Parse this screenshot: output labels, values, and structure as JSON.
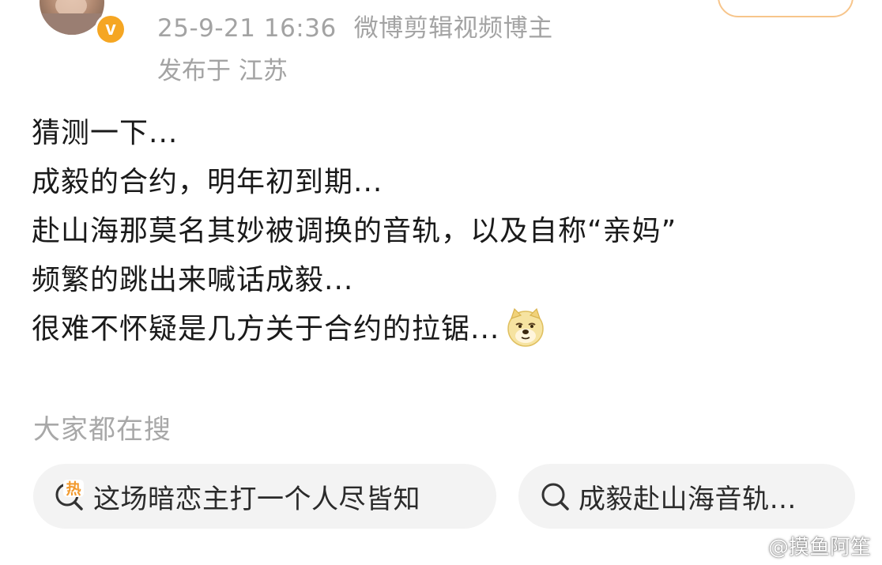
{
  "header": {
    "timestamp": "25-9-21 16:36",
    "source": "微博剪辑视频博主",
    "location": "发布于 江苏",
    "verified_badge": "v"
  },
  "post": {
    "lines": [
      "猜测一下...",
      "成毅的合约，明年初到期...",
      "赴山海那莫名其妙被调换的音轨，以及自称“亲妈”",
      "频繁的跳出来喊话成毅...",
      "很难不怀疑是几方关于合约的拉锯..."
    ],
    "emoji": "doge-emoji"
  },
  "searches": {
    "title": "大家都在搜",
    "items": [
      {
        "label": "这场暗恋主打一个人尽皆知",
        "icon": "hot-search-icon",
        "hot_badge": "热"
      },
      {
        "label": "成毅赴山海音轨…",
        "icon": "search-icon"
      }
    ]
  },
  "watermark": {
    "text": "@摸鱼阿笙",
    "icon": "weibo-logo-icon"
  },
  "colors": {
    "meta_gray": "#a3a3a3",
    "chip_bg": "#f3f3f3",
    "badge_orange": "#f5a623",
    "hot_orange": "#f29a2e",
    "follow_border": "#f7c58b"
  }
}
